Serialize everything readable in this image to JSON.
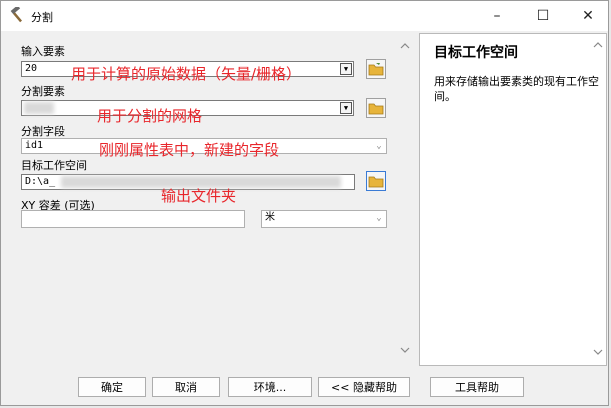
{
  "window": {
    "title": "分割",
    "minimize": "–",
    "maximize": "☐",
    "close": "✕"
  },
  "form": {
    "input_features": {
      "label": "输入要素",
      "value": "20"
    },
    "split_features": {
      "label": "分割要素",
      "value": ""
    },
    "split_field": {
      "label": "分割字段",
      "value": "id1"
    },
    "target_workspace": {
      "label": "目标工作空间",
      "value": "D:\\a_"
    },
    "xy_tolerance": {
      "label": "XY 容差 (可选)",
      "value": "",
      "unit": "米"
    }
  },
  "annotations": {
    "input_note": "用于计算的原始数据（矢量/栅格）",
    "split_note": "用于分割的网格",
    "field_note": "刚刚属性表中，新建的字段",
    "workspace_note": "输出文件夹"
  },
  "help": {
    "title": "目标工作空间",
    "body": "用来存储输出要素类的现有工作空间。"
  },
  "buttons": {
    "ok": "确定",
    "cancel": "取消",
    "environments": "环境...",
    "hide_help": "<< 隐藏帮助",
    "tool_help": "工具帮助"
  },
  "colors": {
    "annotation": "#e8262b",
    "folder": "#e7b43b"
  }
}
